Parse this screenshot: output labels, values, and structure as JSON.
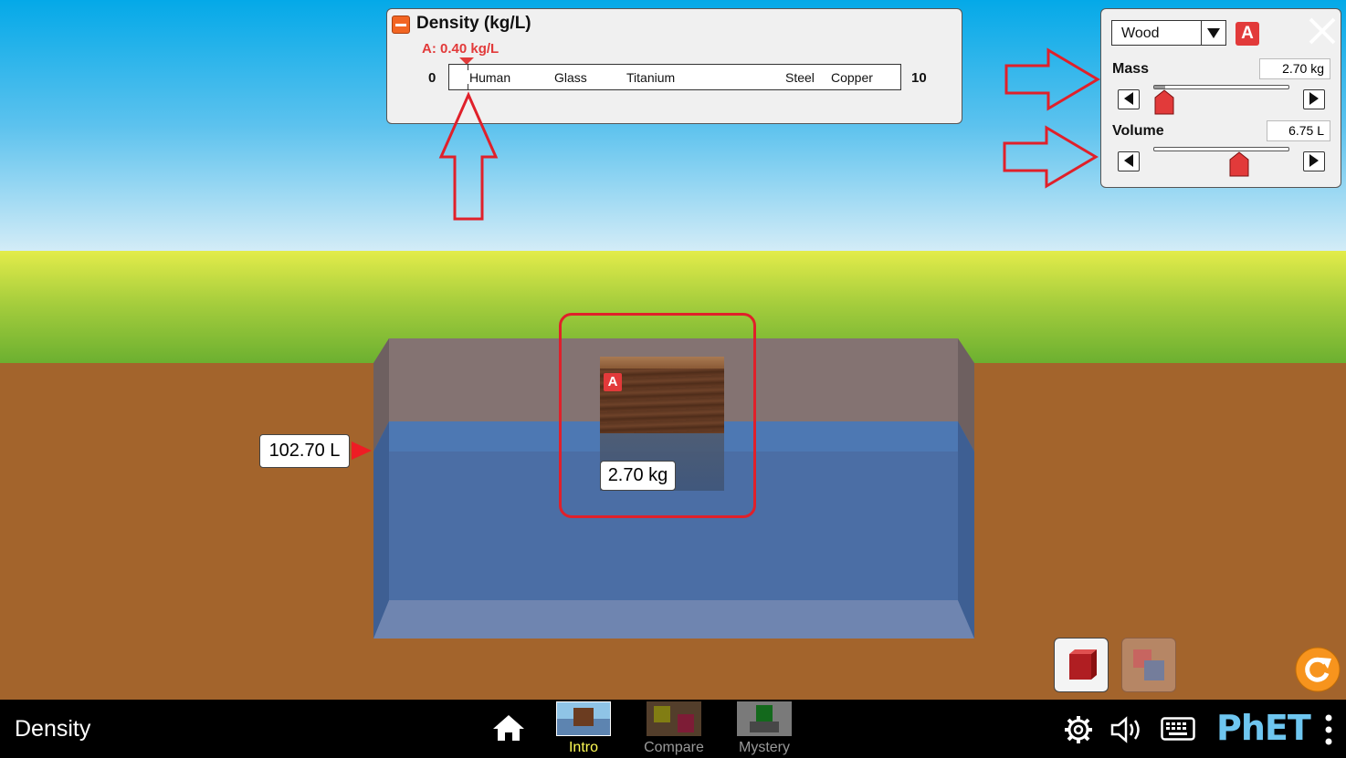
{
  "app": {
    "title": "Density"
  },
  "density_meter": {
    "title": "Density (kg/L)",
    "indicator": "A: 0.40 kg/L",
    "indicator_value": 0.4,
    "min_label": "0",
    "max_label": "10",
    "references": [
      "Human",
      "Glass",
      "Titanium",
      "Steel",
      "Copper"
    ]
  },
  "controls": {
    "material": "Wood",
    "block_badge": "A",
    "mass": {
      "label": "Mass",
      "value_text": "2.70 kg",
      "fraction": 0.08
    },
    "volume": {
      "label": "Volume",
      "value_text": "6.75 L",
      "fraction": 0.63
    }
  },
  "pool": {
    "volume_text": "102.70 L"
  },
  "block": {
    "badge": "A",
    "mass_text": "2.70 kg"
  },
  "nav": {
    "tabs": [
      {
        "label": "Intro",
        "selected": true
      },
      {
        "label": "Compare",
        "selected": false
      },
      {
        "label": "Mystery",
        "selected": false
      }
    ],
    "brand": "PhET"
  },
  "colors": {
    "accent_red": "#e23a3a",
    "annotation_red": "#e0202a",
    "selected_tab": "#fffc55",
    "brand_blue": "#6ec6f0",
    "water": "#4b6fa6"
  }
}
